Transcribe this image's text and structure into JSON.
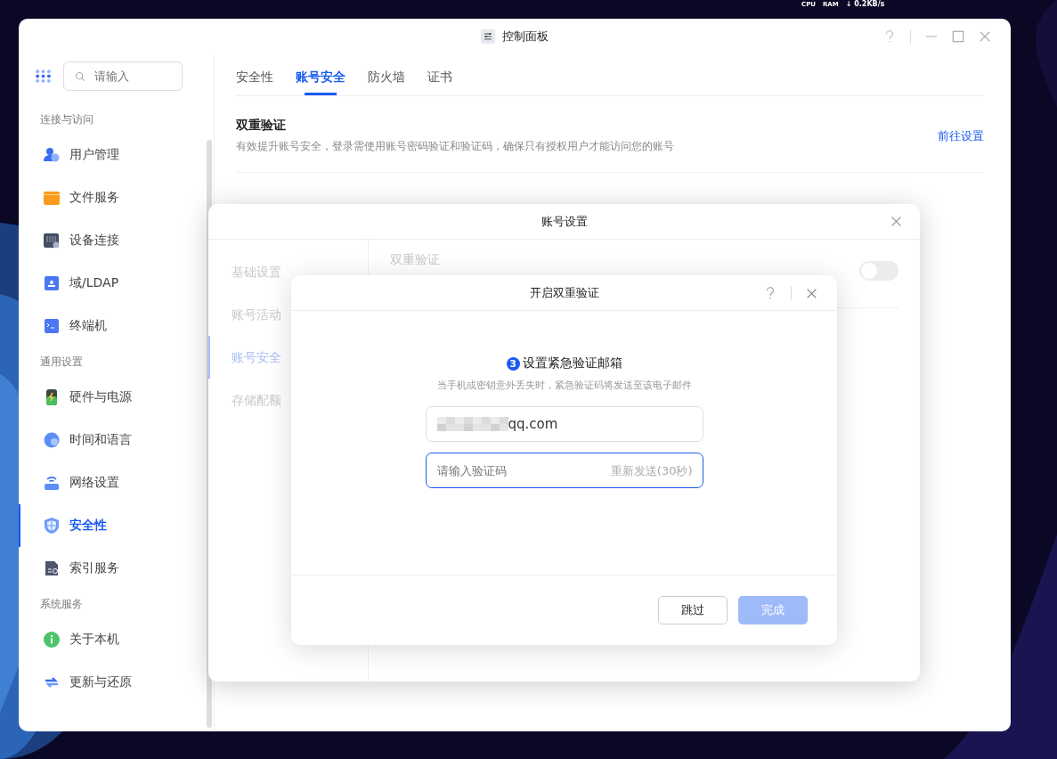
{
  "desktop_bar": {
    "items": [
      "CPU",
      "RAM",
      "↓ 0.2KB/s"
    ]
  },
  "window": {
    "title": "控制面板"
  },
  "sidebar": {
    "search": {
      "placeholder": "请输入"
    },
    "groups": [
      {
        "title": "连接与访问",
        "items": [
          {
            "label": "用户管理",
            "kind": "user",
            "selected": false
          },
          {
            "label": "文件服务",
            "kind": "folder",
            "selected": false
          },
          {
            "label": "设备连接",
            "kind": "device",
            "selected": false
          },
          {
            "label": "域/LDAP",
            "kind": "ldap",
            "selected": false
          },
          {
            "label": "终端机",
            "kind": "terminal",
            "selected": false
          }
        ]
      },
      {
        "title": "通用设置",
        "items": [
          {
            "label": "硬件与电源",
            "kind": "battery",
            "selected": false
          },
          {
            "label": "时间和语言",
            "kind": "globe",
            "selected": false
          },
          {
            "label": "网络设置",
            "kind": "router",
            "selected": false
          },
          {
            "label": "安全性",
            "kind": "shield",
            "selected": true
          },
          {
            "label": "索引服务",
            "kind": "index",
            "selected": false
          }
        ]
      },
      {
        "title": "系统服务",
        "items": [
          {
            "label": "关于本机",
            "kind": "info",
            "selected": false
          },
          {
            "label": "更新与还原",
            "kind": "refresh",
            "selected": false
          }
        ]
      }
    ]
  },
  "tabs": [
    {
      "label": "安全性",
      "selected": false
    },
    {
      "label": "账号安全",
      "selected": true
    },
    {
      "label": "防火墙",
      "selected": false
    },
    {
      "label": "证书",
      "selected": false
    }
  ],
  "setting": {
    "title": "双重验证",
    "description": "有效提升账号安全，登录需使用账号密码验证和验证码，确保只有授权用户才能访问您的账号",
    "link": "前往设置"
  },
  "account_dialog": {
    "title": "账号设置",
    "nav": [
      {
        "label": "基础设置",
        "selected": false
      },
      {
        "label": "账号活动",
        "selected": false
      },
      {
        "label": "账号安全",
        "selected": true
      },
      {
        "label": "存储配额",
        "selected": false
      }
    ],
    "row": {
      "title": "双重验证",
      "on": false
    }
  },
  "twofa_dialog": {
    "title": "开启双重验证",
    "step": "3",
    "heading": "设置紧急验证邮箱",
    "hint": "当手机或密钥意外丢失时，紧急验证码将发送至该电子邮件",
    "email": {
      "value": "qq.com",
      "masked": true
    },
    "code": {
      "placeholder": "请输入验证码",
      "action": "重新发送(30秒)"
    },
    "buttons": [
      {
        "label": "跳过",
        "kind": "secondary",
        "disabled": false
      },
      {
        "label": "完成",
        "kind": "primary",
        "disabled": true
      }
    ]
  }
}
